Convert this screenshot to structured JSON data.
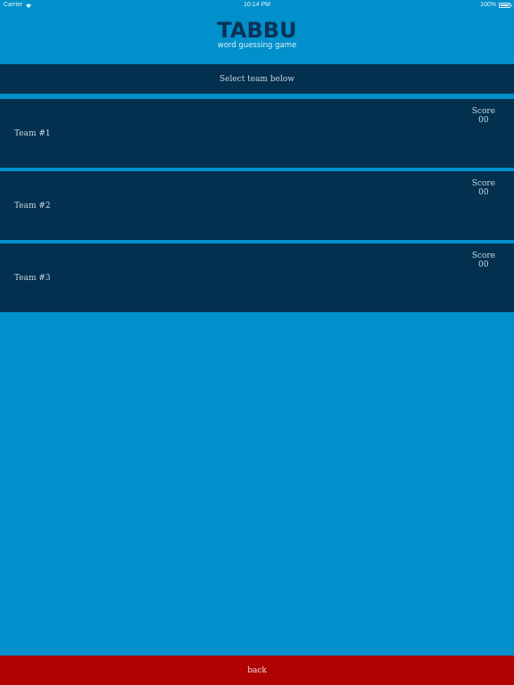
{
  "status_bar": {
    "carrier": "Carrier",
    "time": "10:14 PM",
    "battery": "100%",
    "icons": [
      "wifi-icon",
      "battery-icon"
    ]
  },
  "logo": {
    "title": "TABBU",
    "subtitle": "word guessing game"
  },
  "header": {
    "text": "Select team below"
  },
  "teams": [
    {
      "name": "Team #1",
      "score_label": "Score",
      "score": "00"
    },
    {
      "name": "Team #2",
      "score_label": "Score",
      "score": "00"
    },
    {
      "name": "Team #3",
      "score_label": "Score",
      "score": "00"
    }
  ],
  "footer": {
    "back_label": "back"
  },
  "colors": {
    "background": "#0090cc",
    "panel": "#03304e",
    "back_button": "#b00202",
    "logo": "#0a3356"
  }
}
